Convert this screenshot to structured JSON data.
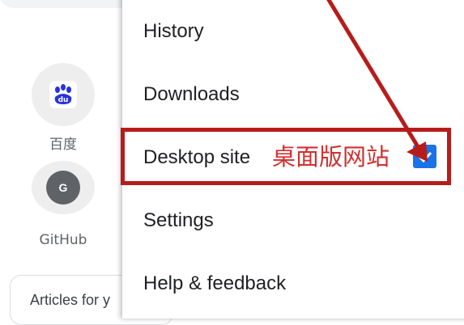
{
  "shortcuts": [
    {
      "label": "百度",
      "icon": "baidu-paw-icon",
      "badge_text": "du",
      "color": "#2932e1"
    },
    {
      "label": "GitHub",
      "icon": "github-letter-icon",
      "letter": "G"
    }
  ],
  "articles_card": {
    "text": "Articles for y"
  },
  "menu": {
    "items": {
      "history": "History",
      "downloads": "Downloads",
      "desktop_site": "Desktop site",
      "settings": "Settings",
      "help": "Help & feedback"
    },
    "desktop_site_checked": true
  },
  "annotation": {
    "text": "桌面版网站",
    "color": "#d32f2f",
    "box_color": "#b71c1c"
  },
  "colors": {
    "checkbox": "#1a73e8",
    "menu_text": "#202124"
  }
}
